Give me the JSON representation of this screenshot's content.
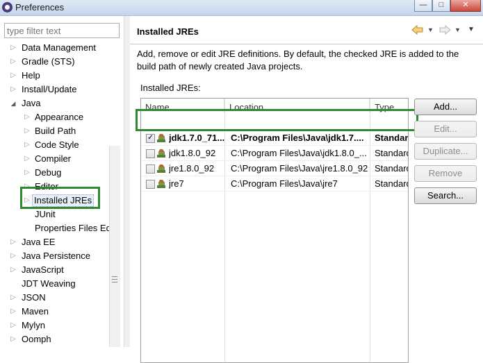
{
  "window": {
    "title": "Preferences",
    "minimize_label": "—",
    "maximize_label": "□",
    "close_label": "✕"
  },
  "filter": {
    "placeholder": "type filter text"
  },
  "tree": {
    "items": [
      {
        "label": "Data Management"
      },
      {
        "label": "Gradle (STS)"
      },
      {
        "label": "Help"
      },
      {
        "label": "Install/Update"
      },
      {
        "label": "Java"
      },
      {
        "label": "Appearance"
      },
      {
        "label": "Build Path"
      },
      {
        "label": "Code Style"
      },
      {
        "label": "Compiler"
      },
      {
        "label": "Debug"
      },
      {
        "label": "Editor"
      },
      {
        "label": "Installed JREs"
      },
      {
        "label": "JUnit"
      },
      {
        "label": "Properties Files Ed"
      },
      {
        "label": "Java EE"
      },
      {
        "label": "Java Persistence"
      },
      {
        "label": "JavaScript"
      },
      {
        "label": "JDT Weaving"
      },
      {
        "label": "JSON"
      },
      {
        "label": "Maven"
      },
      {
        "label": "Mylyn"
      },
      {
        "label": "Oomph"
      }
    ]
  },
  "page": {
    "title": "Installed JREs",
    "description": "Add, remove or edit JRE definitions. By default, the checked JRE is added to the build path of newly created Java projects.",
    "list_label": "Installed JREs:"
  },
  "table": {
    "columns": [
      "Name",
      "Location",
      "Type"
    ],
    "rows": [
      {
        "name": "jdk1.7.0_71...",
        "location": "C:\\Program Files\\Java\\jdk1.7....",
        "type": "Standard",
        "checked": true
      },
      {
        "name": "jdk1.8.0_92",
        "location": "C:\\Program Files\\Java\\jdk1.8.0_...",
        "type": "Standard",
        "checked": false
      },
      {
        "name": "jre1.8.0_92",
        "location": "C:\\Program Files\\Java\\jre1.8.0_92",
        "type": "Standard",
        "checked": false
      },
      {
        "name": "jre7",
        "location": "C:\\Program Files\\Java\\jre7",
        "type": "Standard",
        "checked": false
      }
    ]
  },
  "buttons": {
    "add": "Add...",
    "edit": "Edit...",
    "duplicate": "Duplicate...",
    "remove": "Remove",
    "search": "Search..."
  },
  "icons": {
    "app": "eclipse-icon",
    "back": "back-arrow-icon",
    "forward": "forward-arrow-icon",
    "menu": "view-menu-icon",
    "jre": "jre-library-icon"
  },
  "colors": {
    "highlight_box": "#2f8a2f",
    "back_arrow": "#d9a23b"
  }
}
